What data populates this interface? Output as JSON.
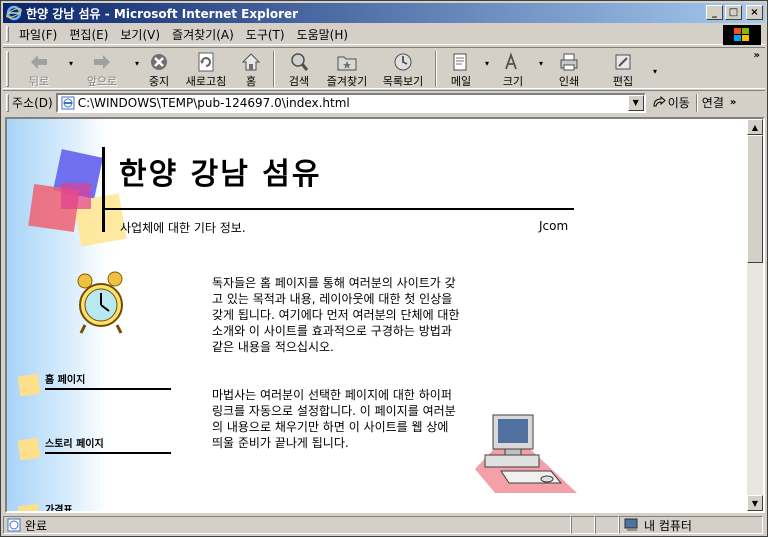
{
  "window": {
    "title": "한양 강남 섬유 - Microsoft Internet Explorer",
    "minimize_label": "_",
    "maximize_label": "□",
    "close_label": "×"
  },
  "menu": [
    "파일(F)",
    "편집(E)",
    "보기(V)",
    "즐겨찾기(A)",
    "도구(T)",
    "도움말(H)"
  ],
  "toolbar": {
    "back": "뒤로",
    "forward": "앞으로",
    "stop": "중지",
    "refresh": "새로고침",
    "home": "홈",
    "search": "검색",
    "favorites": "즐겨찾기",
    "history": "목록보기",
    "mail": "메일",
    "size": "크기",
    "print": "인쇄",
    "edit": "편집",
    "more": "»"
  },
  "address": {
    "label": "주소(D)",
    "value": "C:\\WINDOWS\\TEMP\\pub-124697.0\\index.html",
    "go": "이동",
    "links": "연결",
    "more": "»"
  },
  "page": {
    "title": "한양 강남 섬유",
    "subtitle": "사업체에 대한 기타 정보.",
    "company": "Jcom",
    "paragraph1": "독자들은 홈 페이지를 통해 여러분의 사이트가 갖고 있는 목적과 내용, 레이아웃에 대한 첫 인상을 갖게 됩니다. 여기에다 먼저 여러분의 단체에 대한 소개와 이 사이트를 효과적으로 구경하는 방법과 같은 내용을 적으십시오.",
    "paragraph2": "마법사는 여러분이 선택한 페이지에 대한 하이퍼링크를 자동으로 설정합니다. 이 페이지를 여러분의 내용으로 채우기만 하면 이 사이트를 웹 상에 띄울 준비가 끝나게 됩니다.",
    "nav": [
      "홈 페이지",
      "스토리 페이지",
      "가격표"
    ]
  },
  "status": {
    "text": "완료",
    "zone": "내 컴퓨터"
  },
  "colors": {
    "titlebar_start": "#0a246a",
    "titlebar_end": "#a6caf0",
    "chrome": "#d4d0c8",
    "page_gradient": "#a8d4f8",
    "nav_square": "#ffe08a"
  }
}
